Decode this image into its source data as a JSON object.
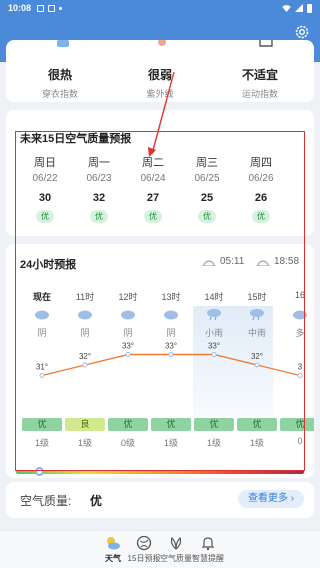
{
  "status_bar": {
    "time": "10:08"
  },
  "index": {
    "items": [
      {
        "value": "很热",
        "label": "穿衣指数"
      },
      {
        "value": "很弱",
        "label": "紫外线"
      },
      {
        "value": "不适宜",
        "label": "运动指数"
      }
    ]
  },
  "air_forecast": {
    "title": "未来15日空气质量预报",
    "days": [
      {
        "weekday": "周日",
        "date": "06/22",
        "aqi": "30",
        "level": "优"
      },
      {
        "weekday": "周一",
        "date": "06/23",
        "aqi": "32",
        "level": "优"
      },
      {
        "weekday": "周二",
        "date": "06/24",
        "aqi": "27",
        "level": "优"
      },
      {
        "weekday": "周三",
        "date": "06/25",
        "aqi": "25",
        "level": "优"
      },
      {
        "weekday": "周四",
        "date": "06/26",
        "aqi": "26",
        "level": "优"
      }
    ]
  },
  "hourly": {
    "title": "24小时预报",
    "sunrise": "05:11",
    "sunset": "18:58",
    "hours": [
      {
        "time": "现在",
        "cond": "阴",
        "temp": 31,
        "temp_label": "31°",
        "aq": "优",
        "level": "1级",
        "icon": "cloud-icon"
      },
      {
        "time": "11时",
        "cond": "阴",
        "temp": 32,
        "temp_label": "32°",
        "aq": "良",
        "level": "1级",
        "icon": "cloud-icon"
      },
      {
        "time": "12时",
        "cond": "阴",
        "temp": 33,
        "temp_label": "33°",
        "aq": "优",
        "level": "0级",
        "icon": "cloud-icon"
      },
      {
        "time": "13时",
        "cond": "阴",
        "temp": 33,
        "temp_label": "33°",
        "aq": "优",
        "level": "1级",
        "icon": "cloud-icon"
      },
      {
        "time": "14时",
        "cond": "小雨",
        "temp": 33,
        "temp_label": "33°",
        "aq": "优",
        "level": "1级",
        "icon": "rain-icon"
      },
      {
        "time": "15时",
        "cond": "中雨",
        "temp": 32,
        "temp_label": "32°",
        "aq": "优",
        "level": "1级",
        "icon": "rain-icon"
      },
      {
        "time": "16",
        "cond": "多",
        "temp": 31,
        "temp_label": "3",
        "aq": "优",
        "level": "0",
        "icon": "cloud-icon"
      }
    ]
  },
  "air_quality": {
    "label": "空气质量:",
    "value": "优",
    "more": "查看更多 ›"
  },
  "bottom_nav": [
    {
      "label": "天气",
      "icon": "weather-icon"
    },
    {
      "label": "15日预报",
      "icon": "globe-icon"
    },
    {
      "label": "空气质量",
      "icon": "leaf-icon"
    },
    {
      "label": "智慧提醒",
      "icon": "bell-icon"
    }
  ],
  "colors": {
    "header_blue": "#4b8ad9",
    "annotation_red": "#e03131",
    "temp_line": "#f07c36",
    "accent_blue": "#2f7de0"
  }
}
